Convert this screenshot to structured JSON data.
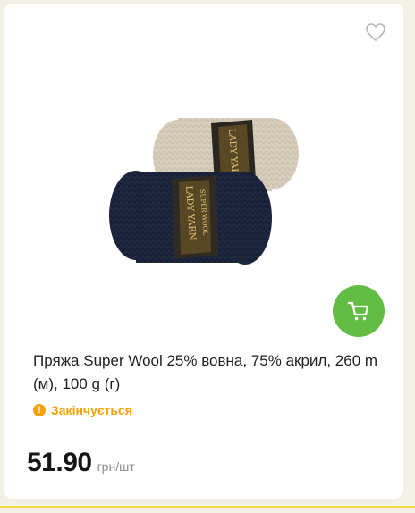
{
  "product": {
    "title": "Пряжа Super Wool 25% вовна, 75% акрил, 260 m (м), 100 g (г)",
    "status": "Закінчується",
    "price": "51.90",
    "unit": "грн/шт",
    "brand_label": "LADY YARN",
    "sub_label": "SUPER WOOL"
  },
  "icons": {
    "favorite": "heart-outline-icon",
    "cart": "shopping-cart-icon",
    "status": "warning-icon"
  },
  "colors": {
    "cart_button": "#63bd44",
    "status": "#f5a10a",
    "accent_line": "#f1d94a"
  }
}
